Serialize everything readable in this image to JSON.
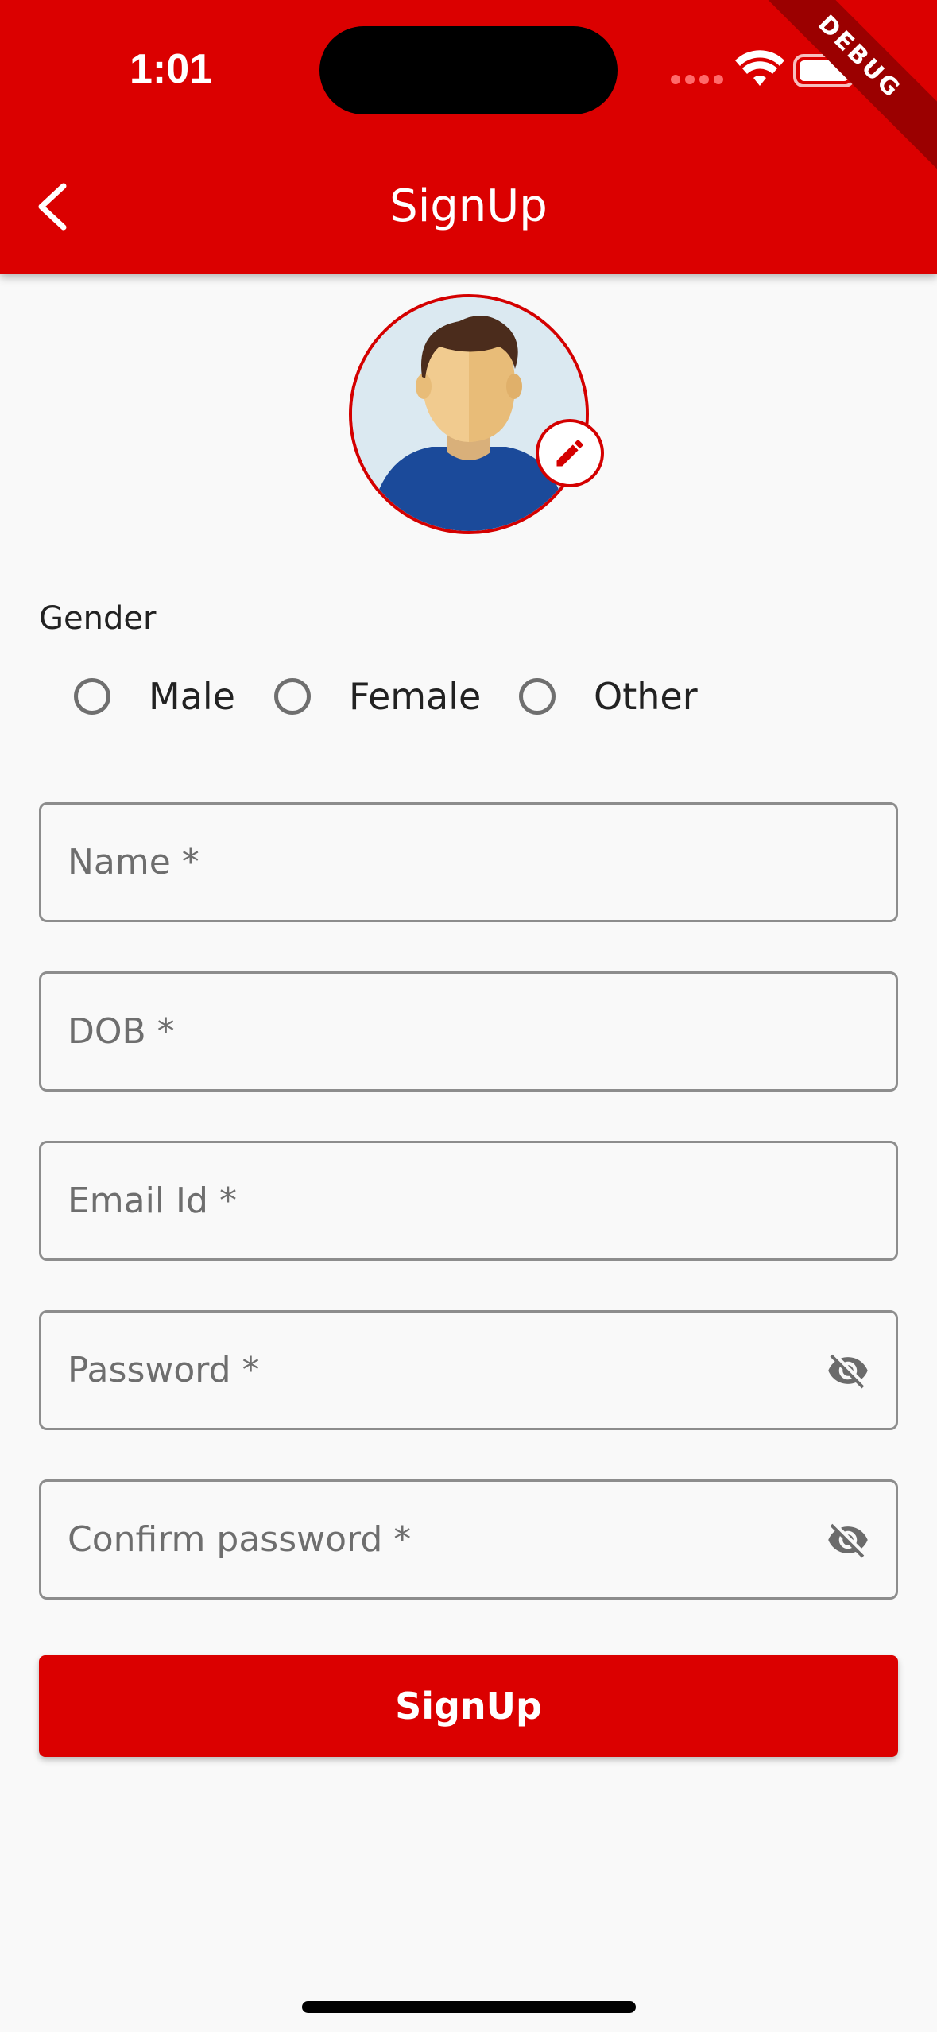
{
  "status_bar": {
    "time": "1:01"
  },
  "debug_banner": {
    "label": "DEBUG"
  },
  "app_bar": {
    "title": "SignUp",
    "background_color": "#db0000"
  },
  "gender": {
    "label": "Gender",
    "options": [
      {
        "label": "Male",
        "selected": false
      },
      {
        "label": "Female",
        "selected": false
      },
      {
        "label": "Other",
        "selected": false
      }
    ]
  },
  "form": {
    "name": {
      "placeholder": "Name *",
      "value": ""
    },
    "dob": {
      "placeholder": "DOB *",
      "value": ""
    },
    "email": {
      "placeholder": "Email Id *",
      "value": ""
    },
    "password": {
      "placeholder": "Password *",
      "value": "",
      "toggle_icon": "visibility-off-icon"
    },
    "confirm_password": {
      "placeholder": "Confirm password *",
      "value": "",
      "toggle_icon": "visibility-off-icon"
    }
  },
  "signup_button": {
    "label": "SignUp"
  },
  "colors": {
    "accent": "#db0000",
    "background": "#f9f9f9",
    "border": "#8d8d8d"
  }
}
